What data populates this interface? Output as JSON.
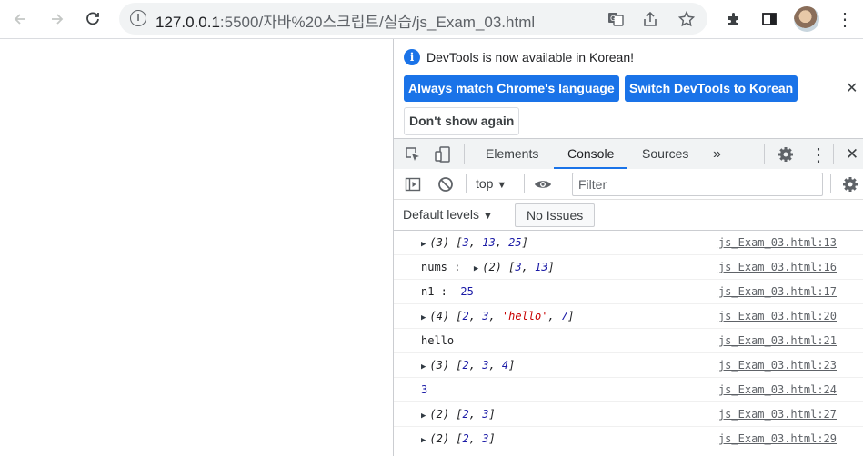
{
  "browser": {
    "url_host": "127.0.0.1",
    "url_rest": ":5500/자바%20스크립트/실습/js_Exam_03.html",
    "icons": [
      "back-icon",
      "forward-icon",
      "reload-icon",
      "info-icon",
      "translate-icon",
      "share-icon",
      "star-icon",
      "extensions-icon",
      "sidepanel-icon",
      "avatar"
    ]
  },
  "devtools": {
    "banner": {
      "message": "DevTools is now available in Korean!",
      "btn_match": "Always match Chrome's language",
      "btn_switch": "Switch DevTools to Korean",
      "btn_dont_show": "Don't show again"
    },
    "tabs": [
      "Elements",
      "Console",
      "Sources"
    ],
    "more_tabs": "»",
    "context": "top",
    "filter_placeholder": "Filter",
    "default_levels": "Default levels",
    "no_issues": "No Issues",
    "accent_color": "#1a73e8"
  },
  "console": [
    {
      "prefix": "",
      "expandable": true,
      "count": "(3)",
      "values": [
        "3",
        "13",
        "25"
      ],
      "source": "js_Exam_03.html:13"
    },
    {
      "prefix": "nums : ",
      "expandable": true,
      "count": "(2)",
      "values": [
        "3",
        "13"
      ],
      "source": "js_Exam_03.html:16"
    },
    {
      "prefix": "n1 :  ",
      "plain_num": "25",
      "source": "js_Exam_03.html:17"
    },
    {
      "prefix": "",
      "expandable": true,
      "count": "(4)",
      "values": [
        "2",
        "3",
        "'hello'",
        "7"
      ],
      "source": "js_Exam_03.html:20"
    },
    {
      "prefix": "hello",
      "source": "js_Exam_03.html:21"
    },
    {
      "prefix": "",
      "expandable": true,
      "count": "(3)",
      "values": [
        "2",
        "3",
        "4"
      ],
      "source": "js_Exam_03.html:23"
    },
    {
      "prefix": "",
      "plain_num": "3",
      "source": "js_Exam_03.html:24"
    },
    {
      "prefix": "",
      "expandable": true,
      "count": "(2)",
      "values": [
        "2",
        "3"
      ],
      "source": "js_Exam_03.html:27"
    },
    {
      "prefix": "",
      "expandable": true,
      "count": "(2)",
      "values": [
        "2",
        "3"
      ],
      "source": "js_Exam_03.html:29"
    }
  ]
}
